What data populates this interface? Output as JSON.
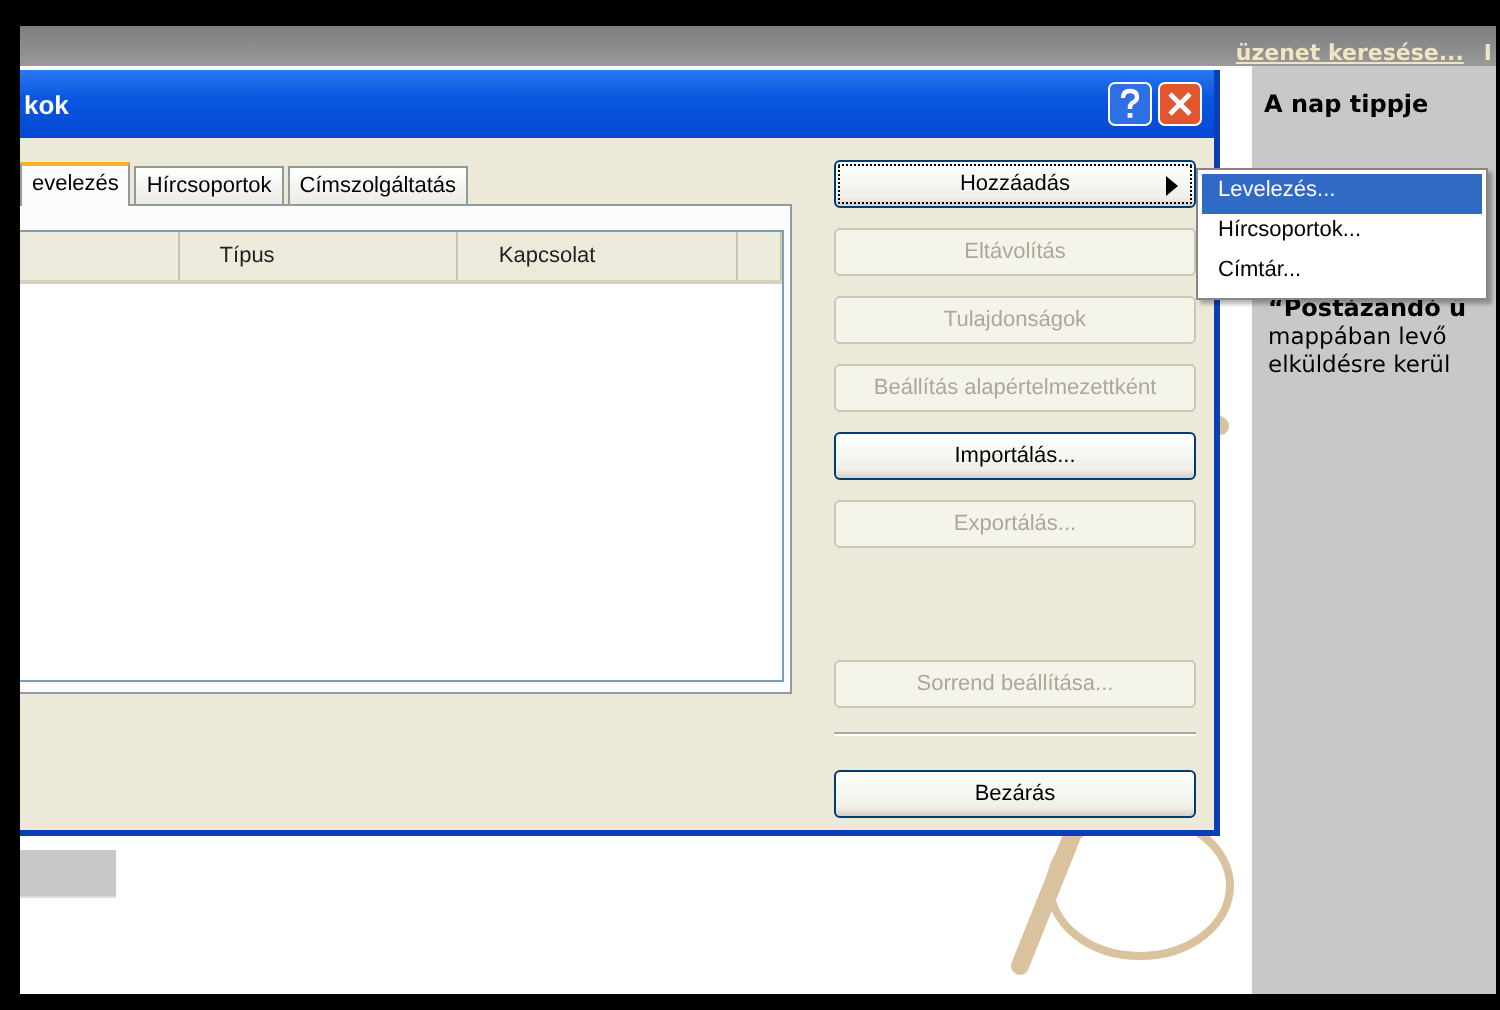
{
  "top_bar": {
    "search_link": "üzenet keresése...",
    "cut_text": "I"
  },
  "tip_panel": {
    "title": "A nap tippje",
    "lines": [
      {
        "kind": "bold",
        "text": "“Postázandó ü"
      },
      {
        "kind": "plain",
        "text": "mappában levő"
      },
      {
        "kind": "plain",
        "text": "elküldésre kerül"
      }
    ]
  },
  "dialog": {
    "title": "kok",
    "tabs": [
      {
        "label": "evelezés",
        "selected": true
      },
      {
        "label": "Hírcsoportok",
        "selected": false
      },
      {
        "label": "Címszolgáltatás",
        "selected": false
      }
    ],
    "list": {
      "columns": [
        "Típus",
        "Kapcsolat"
      ]
    },
    "buttons": [
      {
        "label": "Hozzáadás",
        "kind": "submenu",
        "disabled": false,
        "focused": true
      },
      {
        "label": "Eltávolítás",
        "kind": "plain",
        "disabled": true,
        "focused": false
      },
      {
        "label": "Tulajdonságok",
        "kind": "plain",
        "disabled": true,
        "focused": false
      },
      {
        "label": "Beállítás alapértelmezettként",
        "kind": "plain",
        "disabled": true,
        "focused": false
      },
      {
        "label": "Importálás...",
        "kind": "plain",
        "disabled": false,
        "focused": false
      },
      {
        "label": "Exportálás...",
        "kind": "plain",
        "disabled": true,
        "focused": false
      }
    ],
    "lower_buttons": [
      {
        "label": "Sorrend beállítása...",
        "disabled": true,
        "focused": false
      }
    ],
    "close_button": "Bezárás"
  },
  "context_menu": {
    "items": [
      {
        "label": "Levelezés...",
        "selected": true
      },
      {
        "label": "Hírcsoportok...",
        "selected": false
      },
      {
        "label": "Címtár...",
        "selected": false
      }
    ]
  }
}
